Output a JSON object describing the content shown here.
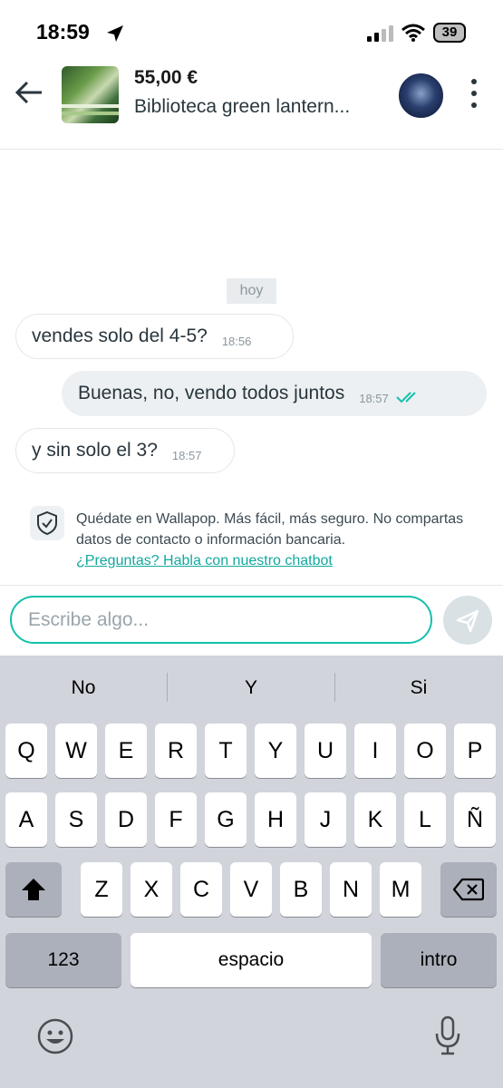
{
  "status_bar": {
    "time": "18:59",
    "battery": "39"
  },
  "header": {
    "price": "55,00 €",
    "title": "Biblioteca green lantern..."
  },
  "chat": {
    "date_label": "hoy",
    "messages": [
      {
        "direction": "in",
        "text": "vendes solo del 4-5?",
        "time": "18:56"
      },
      {
        "direction": "out",
        "text": "Buenas, no, vendo todos juntos",
        "time": "18:57"
      },
      {
        "direction": "in",
        "text": "y sin solo el 3?",
        "time": "18:57"
      }
    ]
  },
  "notice": {
    "text": "Quédate en Wallapop. Más fácil, más seguro. No compartas datos de contacto o información bancaria.",
    "link": "¿Preguntas? Habla con nuestro chatbot"
  },
  "composer": {
    "placeholder": "Escribe algo..."
  },
  "keyboard": {
    "suggestions": [
      "No",
      "Y",
      "Si"
    ],
    "row1": [
      "Q",
      "W",
      "E",
      "R",
      "T",
      "Y",
      "U",
      "I",
      "O",
      "P"
    ],
    "row2": [
      "A",
      "S",
      "D",
      "F",
      "G",
      "H",
      "J",
      "K",
      "L",
      "Ñ"
    ],
    "row3": [
      "Z",
      "X",
      "C",
      "V",
      "B",
      "N",
      "M"
    ],
    "numbers_key": "123",
    "space_key": "espacio",
    "return_key": "intro"
  }
}
